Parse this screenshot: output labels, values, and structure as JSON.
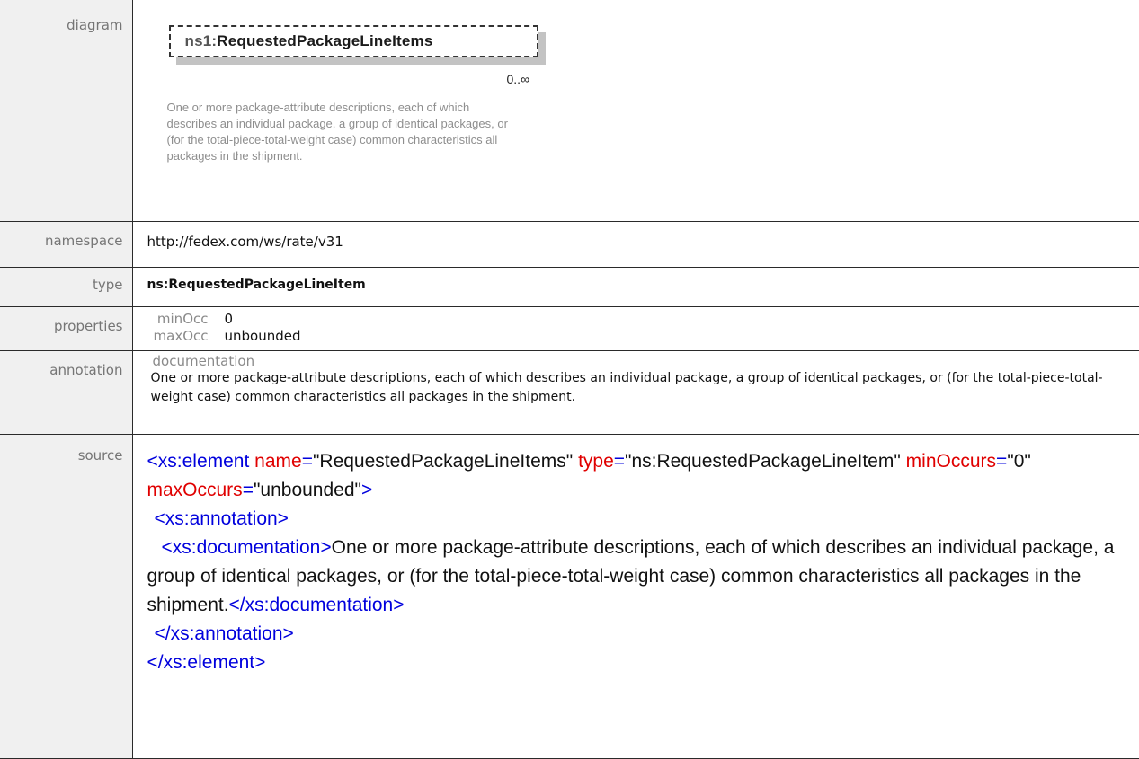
{
  "labels": {
    "diagram": "diagram",
    "namespace": "namespace",
    "type": "type",
    "properties": "properties",
    "annotation": "annotation",
    "source": "source"
  },
  "diagram": {
    "ns_prefix": "ns1:",
    "element_name": "RequestedPackageLineItems",
    "occurrence": "0..∞",
    "description": "One or more package-attribute descriptions, each of which describes an individual package, a group of identical packages, or (for the total-piece-total-weight case) common characteristics all packages in the shipment."
  },
  "namespace": "http://fedex.com/ws/rate/v31",
  "type": "ns:RequestedPackageLineItem",
  "properties": {
    "minOcc_label": "minOcc",
    "minOcc_value": "0",
    "maxOcc_label": "maxOcc",
    "maxOcc_value": "unbounded"
  },
  "annotation": {
    "title": "documentation",
    "text": "One or more package-attribute descriptions, each of which describes an individual package, a group of identical packages, or (for the total-piece-total-weight  case) common characteristics all packages in the shipment."
  },
  "source": {
    "open_tag": "<xs:element",
    "name_attr": "name",
    "name_value": "\"RequestedPackageLineItems\"",
    "type_attr": "type",
    "type_value": "\"ns:RequestedPackageLineItem\"",
    "minOccurs_attr": "minOccurs",
    "minOccurs_value": "\"0\"",
    "maxOccurs_attr": "maxOccurs",
    "maxOccurs_value": "\"unbounded\"",
    "open_tag_end": ">",
    "annotation_open": "<xs:annotation>",
    "documentation_open": "<xs:documentation>",
    "documentation_text": "One or more package-attribute descriptions, each of which describes an individual package, a group of identical packages, or (for the total-piece-total-weight case) common characteristics all packages in the shipment.",
    "documentation_close": "</xs:documentation>",
    "annotation_close": "</xs:annotation>",
    "element_close": "</xs:element>"
  }
}
